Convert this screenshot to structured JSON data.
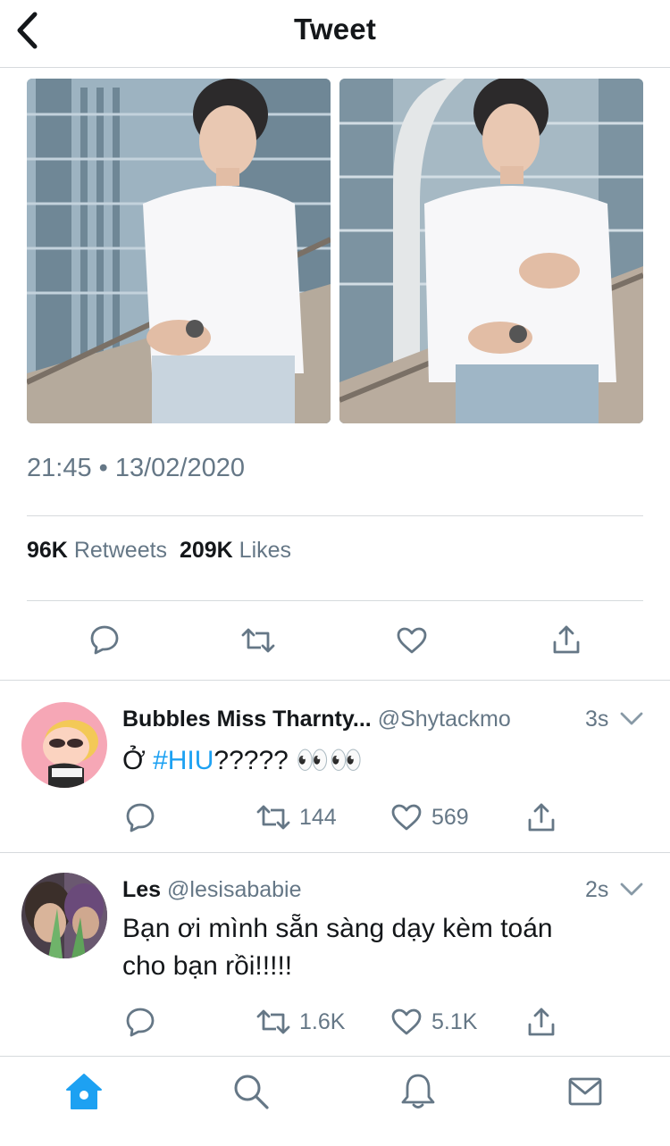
{
  "header": {
    "title": "Tweet"
  },
  "tweet": {
    "timestamp": "21:45 • 13/02/2020",
    "retweets_count": "96K",
    "retweets_label": "Retweets",
    "likes_count": "209K",
    "likes_label": "Likes"
  },
  "replies": [
    {
      "name": "Bubbles Miss Tharnty...",
      "handle": "@Shytackmo",
      "time": "3s",
      "text_prefix": "Ở ",
      "hashtag": "#HIU",
      "text_suffix": "????? 👀👀",
      "retweets": "144",
      "likes": "569"
    },
    {
      "name": "Les",
      "handle": "@lesisababie",
      "time": "2s",
      "text": "Bạn ơi mình sẵn sàng dạy kèm toán cho bạn rồi!!!!!",
      "retweets": "1.6K",
      "likes": "5.1K"
    }
  ],
  "tabs": [
    "home-icon",
    "search-icon",
    "notifications-icon",
    "messages-icon"
  ],
  "colors": {
    "accent": "#1da1f2",
    "secondary_text": "#657786",
    "icon": "#657786"
  }
}
